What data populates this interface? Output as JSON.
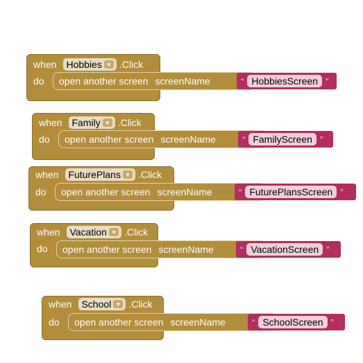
{
  "blocks": [
    {
      "when": "when",
      "component": "Hobbies",
      "event": ".Click",
      "do": "do",
      "call": "open another screen",
      "param": "screenName",
      "quote_open": "“",
      "value": "HobbiesScreen",
      "quote_close": "”"
    },
    {
      "when": "when",
      "component": "Family",
      "event": ".Click",
      "do": "do",
      "call": "open another screen",
      "param": "screenName",
      "quote_open": "“",
      "value": "FamilyScreen",
      "quote_close": "”"
    },
    {
      "when": "when",
      "component": "FuturePlans",
      "event": ".Click",
      "do": "do",
      "call": "open another screen",
      "param": "screenName",
      "quote_open": "“",
      "value": "FuturePlansScreen",
      "quote_close": "”"
    },
    {
      "when": "when",
      "component": "Vacation",
      "event": ".Click",
      "do": "do",
      "call": "open another screen",
      "param": "screenName",
      "quote_open": "“",
      "value": "VacationScreen",
      "quote_close": "”"
    },
    {
      "when": "when",
      "component": "School",
      "event": ".Click",
      "do": "do",
      "call": "open another screen",
      "param": "screenName",
      "quote_open": "“",
      "value": "SchoolScreen",
      "quote_close": "”"
    }
  ],
  "colors": {
    "event_block": "#b28d3b",
    "text_block": "#b32d5e",
    "dropdown": "#e8dcc4"
  },
  "icons": {
    "dropdown_arrow": "triangle-down-icon"
  }
}
